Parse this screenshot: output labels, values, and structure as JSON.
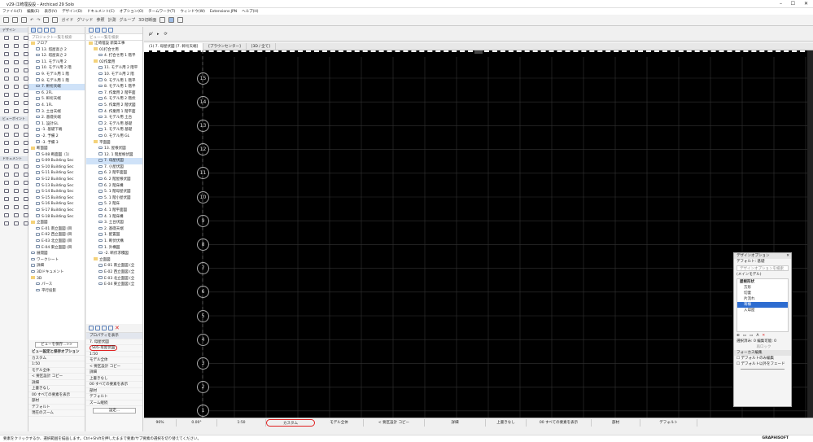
{
  "window": {
    "title": "v29-江崎埋設設 - Archicad 29 Solo"
  },
  "menu": [
    "ファイル(F)",
    "編集(E)",
    "表示(V)",
    "デザイン(D)",
    "ドキュメント(C)",
    "オプション(O)",
    "チームワーク(T)",
    "ウィンドウ(W)",
    "Extensions JPN",
    "ヘルプ(H)"
  ],
  "toolbar": {
    "guide": "ガイド",
    "grid": "グリッド",
    "ref": "参照",
    "layout": "計測",
    "group": "グループ",
    "cutplane": "3D切断面"
  },
  "toolbox": {
    "design": "デザイン",
    "viewpoint": "ビューポイント",
    "document": "ドキュメント"
  },
  "nav1": {
    "search": "プロジェクト一覧を検索",
    "items": [
      {
        "t": "フロア",
        "lvl": 0,
        "folder": true
      },
      {
        "t": "13. 塔屋高さ 2",
        "lvl": 1
      },
      {
        "t": "12. 塔屋高さ 2",
        "lvl": 1
      },
      {
        "t": "11. モデル用 2",
        "lvl": 1
      },
      {
        "t": "10. モデル用 2 階",
        "lvl": 1
      },
      {
        "t": "9. モデル用 1 階",
        "lvl": 1
      },
      {
        "t": "8. モデル用 1 階",
        "lvl": 1
      },
      {
        "t": "7. 軒桁天端",
        "lvl": 1,
        "sel": true
      },
      {
        "t": "6. 2FL",
        "lvl": 1
      },
      {
        "t": "5. 軒桁天端",
        "lvl": 1
      },
      {
        "t": "4. 1FL",
        "lvl": 1
      },
      {
        "t": "3. 土台天端",
        "lvl": 1
      },
      {
        "t": "2. 基礎天端",
        "lvl": 1
      },
      {
        "t": "1. 設計GL",
        "lvl": 1
      },
      {
        "t": "-1. 基礎下端",
        "lvl": 1
      },
      {
        "t": "-2. 予備 2",
        "lvl": 1
      },
      {
        "t": "-3. 予備 3",
        "lvl": 1
      },
      {
        "t": "断面図",
        "lvl": 0,
        "folder": true
      },
      {
        "t": "S-08 断面図（1）",
        "lvl": 1
      },
      {
        "t": "S-09 Building Sec",
        "lvl": 1
      },
      {
        "t": "S-10 Building Sec",
        "lvl": 1
      },
      {
        "t": "S-11 Building Sec",
        "lvl": 1
      },
      {
        "t": "S-12 Building Sec",
        "lvl": 1
      },
      {
        "t": "S-13 Building Sec",
        "lvl": 1
      },
      {
        "t": "S-14 Building Sec",
        "lvl": 1
      },
      {
        "t": "S-15 Building Sec",
        "lvl": 1
      },
      {
        "t": "S-16 Building Sec",
        "lvl": 1
      },
      {
        "t": "S-17 Building Sec",
        "lvl": 1
      },
      {
        "t": "S-18 Building Sec",
        "lvl": 1
      },
      {
        "t": "立面図",
        "lvl": 0,
        "folder": true
      },
      {
        "t": "E-01 南立面図 (目",
        "lvl": 1
      },
      {
        "t": "E-02 西立面図 (目",
        "lvl": 1
      },
      {
        "t": "E-03 北立面図 (目",
        "lvl": 1
      },
      {
        "t": "E-04 東立面図 (目",
        "lvl": 1
      },
      {
        "t": "展開図",
        "lvl": 0
      },
      {
        "t": "ワークシート",
        "lvl": 0
      },
      {
        "t": "詳細",
        "lvl": 0
      },
      {
        "t": "3Dドキュメント",
        "lvl": 0
      },
      {
        "t": "3D",
        "lvl": 0,
        "folder": true
      },
      {
        "t": "パース",
        "lvl": 1
      },
      {
        "t": "平行投影",
        "lvl": 1
      }
    ]
  },
  "nav2": {
    "search": "ビュー一覧を検索",
    "items": [
      {
        "t": "江崎埋設  新築工事",
        "lvl": 0,
        "folder": true
      },
      {
        "t": "01打合せ用",
        "lvl": 1,
        "folder": true
      },
      {
        "t": "4. 打合せ用 1 階平",
        "lvl": 2
      },
      {
        "t": "02作業用",
        "lvl": 1,
        "folder": true
      },
      {
        "t": "11. モデル用 2 階平",
        "lvl": 2
      },
      {
        "t": "10. モデル用 2 階",
        "lvl": 2
      },
      {
        "t": "9. モデル用 1 階平",
        "lvl": 2
      },
      {
        "t": "8. モデル用 1 階平",
        "lvl": 2
      },
      {
        "t": "7. 作業用 2 階平面",
        "lvl": 2
      },
      {
        "t": "6. モデル用 2 階伏",
        "lvl": 2
      },
      {
        "t": "5. 作業用 2 階伏図",
        "lvl": 2
      },
      {
        "t": "4. 作業用 1 階平面",
        "lvl": 2
      },
      {
        "t": "3. モデル用  土台",
        "lvl": 2
      },
      {
        "t": "2. モデル用  基礎",
        "lvl": 2
      },
      {
        "t": "1. モデル用  基礎",
        "lvl": 2
      },
      {
        "t": "0. モデル用  GL",
        "lvl": 2
      },
      {
        "t": "平面図",
        "lvl": 1,
        "folder": true
      },
      {
        "t": "13. 屋根伏図",
        "lvl": 2
      },
      {
        "t": "12. 1 階屋根伏図",
        "lvl": 2
      },
      {
        "t": "7. 母屋伏図",
        "lvl": 2,
        "sel": true
      },
      {
        "t": "7. 小屋伏図",
        "lvl": 2
      },
      {
        "t": "6. 2 階平面図",
        "lvl": 2
      },
      {
        "t": "6. 2 階屋根伏図",
        "lvl": 2
      },
      {
        "t": "6. 2 階床構",
        "lvl": 2
      },
      {
        "t": "5. 1 階母屋伏図",
        "lvl": 2
      },
      {
        "t": "5. 1 階小屋伏図",
        "lvl": 2
      },
      {
        "t": "5. 2 階床",
        "lvl": 2
      },
      {
        "t": "4. 1 階平面図",
        "lvl": 2
      },
      {
        "t": "4. 1 階床構",
        "lvl": 2
      },
      {
        "t": "3. 土台伏図",
        "lvl": 2
      },
      {
        "t": "2. 基礎天端",
        "lvl": 2
      },
      {
        "t": "1. 配置図",
        "lvl": 2
      },
      {
        "t": "1. 断伏伏構",
        "lvl": 2
      },
      {
        "t": "1. 外構図",
        "lvl": 2
      },
      {
        "t": "-2. 断伏求積図",
        "lvl": 2
      },
      {
        "t": "立面図",
        "lvl": 1,
        "folder": true
      },
      {
        "t": "E-01 南立面図 (全",
        "lvl": 2
      },
      {
        "t": "E-02 西立面図 (全",
        "lvl": 2
      },
      {
        "t": "E-03 北立面図 (全",
        "lvl": 2
      },
      {
        "t": "E-04 東立面図 (全",
        "lvl": 2
      }
    ]
  },
  "viewpanel": {
    "save_btn": "ビューを保存...>>",
    "header": "ビュー設定と保存オプション",
    "rows": [
      "カスタム",
      "1:50",
      "モデル全体",
      "< 要区設計 コピー",
      "詳細",
      "上書きなし",
      "00 すべての要素を表示",
      "部材",
      "デフォルト",
      "現在のズーム"
    ]
  },
  "props": {
    "header": "プロパティを表示",
    "rows": [
      "7.",
      "母屋伏図",
      "S05-母屋伏図",
      "1:50",
      "モデル全体",
      "< 要区設計 コピー",
      "詳細",
      "上書きなし",
      "00 すべての要素を表示",
      "部材",
      "デフォルト",
      "ズーム継続"
    ],
    "settings_btn": "設定..."
  },
  "tabs": [
    "(1)  7. 母屋伏図 [7. 軒桁天端]",
    "[プラウンセンター]",
    "[3D / 全て]"
  ],
  "canvas": {
    "bubbles": [
      "15",
      "14",
      "13",
      "12",
      "11",
      "10",
      "9",
      "8",
      "7",
      "6",
      "5",
      "4",
      "3",
      "2",
      "1"
    ]
  },
  "status": [
    "96%",
    "0.00°",
    "1:50",
    "カスタム",
    "モデル全体",
    "< 要区設計 コピー",
    "詳細",
    "上書きなし",
    "00 すべての要素を表示",
    "部材",
    "デフォルト"
  ],
  "palette": {
    "title": "デザインオプション",
    "default": "デフォルト: 基礎",
    "search": "デザインオプションを検索",
    "main": "(メインモデル)",
    "group": "屋根形状",
    "items": [
      "方形",
      "切妻",
      "片流れ",
      "寄棟",
      "入母屋"
    ],
    "selected_index": 3,
    "footer1": "選択済み: 0  編集可能: 0",
    "footer2": "再ロック",
    "focus": "フォーカス編集",
    "chk1": "デフォルトのみ編集",
    "chk2": "デフォルト以外をフェード"
  },
  "bottom": {
    "hint": "要素をクリックするか、選択範囲を描画します。Ctrl+Shiftを押したままで要素/サブ要素の選択を切り替えてください。",
    "brand": "GRAPHISOFT"
  },
  "colors": {
    "accent": "#2d6cd0",
    "canvas": "#000000",
    "highlight": "#cfe2f8",
    "red": "#e02020"
  }
}
